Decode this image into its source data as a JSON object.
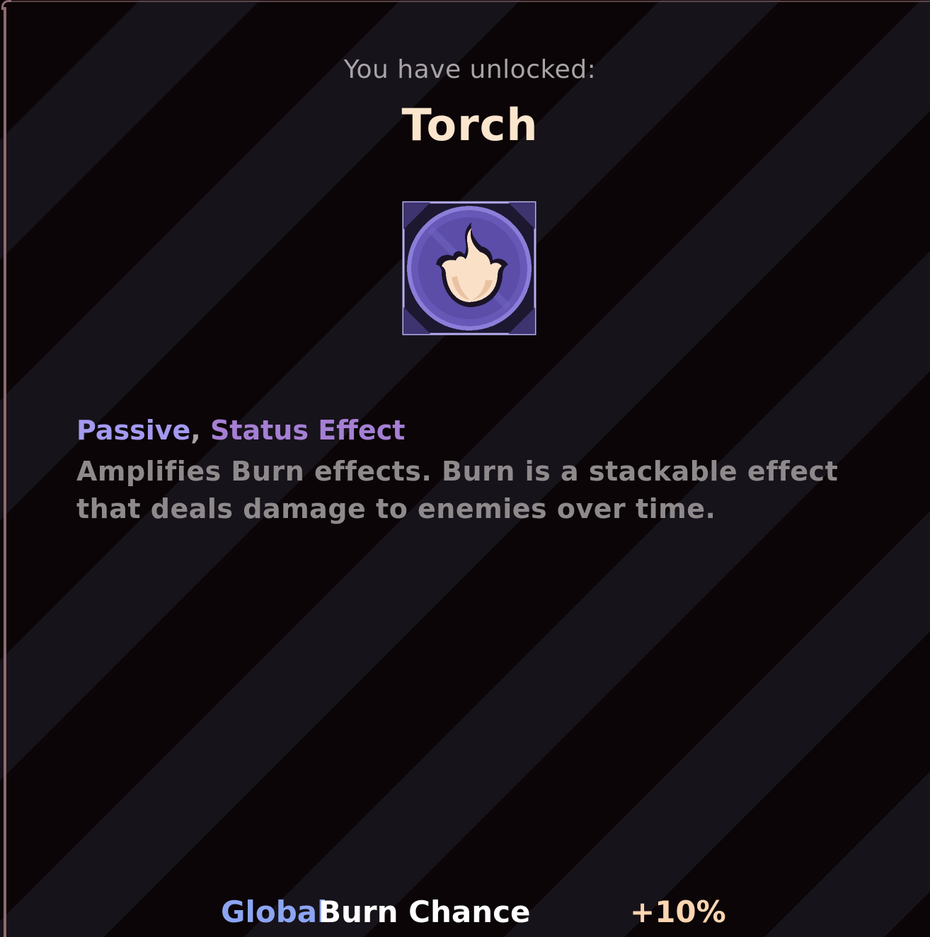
{
  "unlock": {
    "label": "You have unlocked:",
    "item_name": "Torch",
    "icon": "flame-icon"
  },
  "tags": {
    "passive": "Passive",
    "separator": ",",
    "status": "Status Effect"
  },
  "description": "Amplifies Burn effects. Burn is a stackable effect that deals damage to enemies over time.",
  "stat": {
    "scope": "Global",
    "name": "Burn Chance",
    "value": "+10%"
  },
  "colors": {
    "background": "#0b0507",
    "stripe": "#17131a",
    "title": "#fbe6cd",
    "passive_tag": "#a39af0",
    "status_tag": "#a57fd4",
    "global": "#8ca5f2",
    "stat_value": "#fdd5b0",
    "icon_fill": "#6757b6",
    "flame": "#fbe0c8"
  }
}
